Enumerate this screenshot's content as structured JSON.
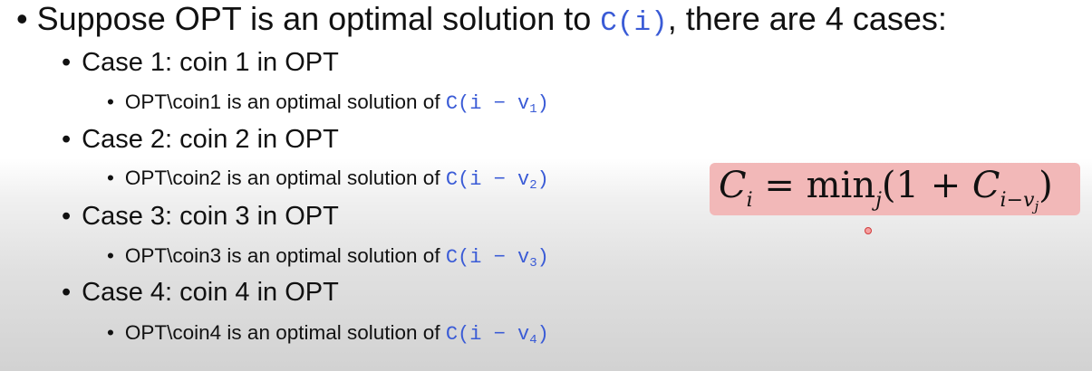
{
  "intro": {
    "bullet": "•",
    "text_before": "Suppose OPT is an optimal solution to ",
    "code": "C(i)",
    "text_after": ", there are 4 cases:"
  },
  "cases": [
    {
      "title": "Case 1: coin 1 in OPT",
      "detail_text": "OPT\\coin1 is an optimal solution of ",
      "code_prefix": "C(i − v",
      "code_sub": "1",
      "code_suffix": ")"
    },
    {
      "title": "Case 2: coin 2 in OPT",
      "detail_text": "OPT\\coin2 is an optimal solution of ",
      "code_prefix": "C(i − v",
      "code_sub": "2",
      "code_suffix": ")"
    },
    {
      "title": "Case 3: coin 3 in OPT",
      "detail_text": "OPT\\coin3 is an optimal solution of ",
      "code_prefix": "C(i − v",
      "code_sub": "3",
      "code_suffix": ")"
    },
    {
      "title": "Case 4: coin 4 in OPT",
      "detail_text": "OPT\\coin4 is an optimal solution of ",
      "code_prefix": "C(i − v",
      "code_sub": "4",
      "code_suffix": ")"
    }
  ],
  "formula": {
    "lhs": "C",
    "lhs_sub": "i",
    "eq": " = min",
    "min_sub": "j",
    "open": "(1 + ",
    "rhs": "C",
    "rhs_sub": "i−v",
    "rhs_sub_sub": "j",
    "close": ")"
  },
  "colors": {
    "code": "#3a5bd6",
    "formula_bg": "#f2b8b8",
    "cursor": "#d23b3b"
  }
}
